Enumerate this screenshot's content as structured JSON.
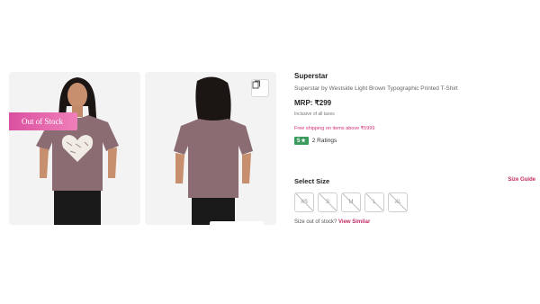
{
  "gallery": {
    "badge": "Out of Stock"
  },
  "product": {
    "brand": "Superstar",
    "title": "Superstar by Westside Light Brown Typographic Printed T-Shirt",
    "price": "MRP: ₹299",
    "tax_note": "Inclusive of all taxes",
    "shipping": "Free shipping on items above ₹5999",
    "rating": "5",
    "ratings_count": "2 Ratings"
  },
  "size": {
    "label": "Select Size",
    "guide_label": "Size Guide",
    "options": [
      "XS",
      "S",
      "M",
      "L",
      "XL"
    ]
  },
  "notice": {
    "text": "Size out of stock?",
    "link": "View Similar"
  },
  "colors": {
    "accent": "#c02a63",
    "rating_green": "#3a9b5c",
    "tshirt": "#8a6c72"
  }
}
